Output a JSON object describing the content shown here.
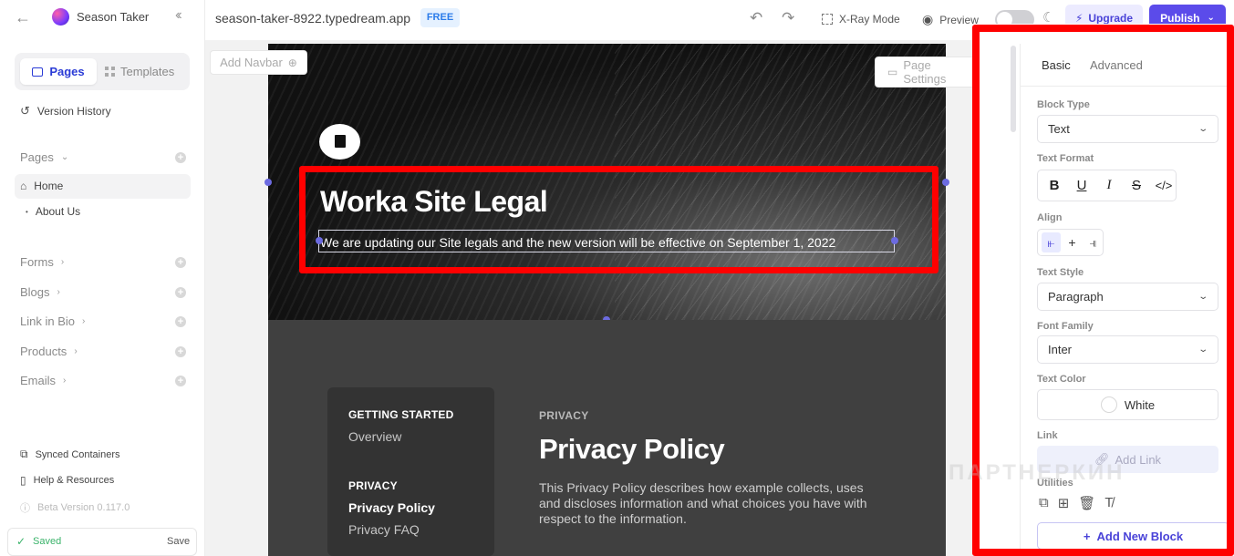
{
  "sidebar": {
    "site_name": "Season Taker",
    "tabs": {
      "pages": "Pages",
      "templates": "Templates"
    },
    "version_history": "Version History",
    "pages_section": "Pages",
    "pages": [
      {
        "label": "Home",
        "active": true
      },
      {
        "label": "About Us",
        "active": false
      }
    ],
    "sections": [
      {
        "label": "Forms"
      },
      {
        "label": "Blogs"
      },
      {
        "label": "Link in Bio"
      },
      {
        "label": "Products"
      },
      {
        "label": "Emails"
      }
    ],
    "synced_containers": "Synced Containers",
    "help": "Help & Resources",
    "beta_version": "Beta Version 0.117.0",
    "status": {
      "saved": "Saved",
      "save": "Save"
    }
  },
  "topbar": {
    "url": "season-taker-8922.typedream.app",
    "badge": "FREE",
    "xray": "X-Ray Mode",
    "preview": "Preview",
    "upgrade": "Upgrade",
    "publish": "Publish"
  },
  "canvas": {
    "add_navbar": "Add Navbar",
    "page_settings": "Page Settings",
    "hero": {
      "title": "Worka Site Legal",
      "subtitle": "We are updating our Site legals and the new version will be effective on September 1, 2022"
    },
    "toc": {
      "group1_heading": "GETTING STARTED",
      "group1_items": [
        "Overview"
      ],
      "group2_heading": "PRIVACY",
      "group2_items": [
        "Privacy Policy",
        "Privacy FAQ"
      ]
    },
    "article": {
      "label": "PRIVACY",
      "title": "Privacy Policy",
      "body": "This Privacy Policy describes how example collects, uses and discloses information and what choices you have with respect to the information."
    }
  },
  "panel": {
    "tabs": {
      "basic": "Basic",
      "advanced": "Advanced"
    },
    "block_type_label": "Block Type",
    "block_type_value": "Text",
    "text_format_label": "Text Format",
    "align_label": "Align",
    "text_style_label": "Text Style",
    "text_style_value": "Paragraph",
    "font_family_label": "Font Family",
    "font_family_value": "Inter",
    "text_color_label": "Text Color",
    "text_color_value": "White",
    "link_label": "Link",
    "add_link": "Add Link",
    "utilities_label": "Utilities",
    "add_new_block": "Add New Block"
  },
  "watermark": "ПАРТНЕРКИН",
  "colors": {
    "accent": "#5b4bea",
    "highlight": "#ff0000",
    "pages_tab": "#2a3bd6"
  }
}
